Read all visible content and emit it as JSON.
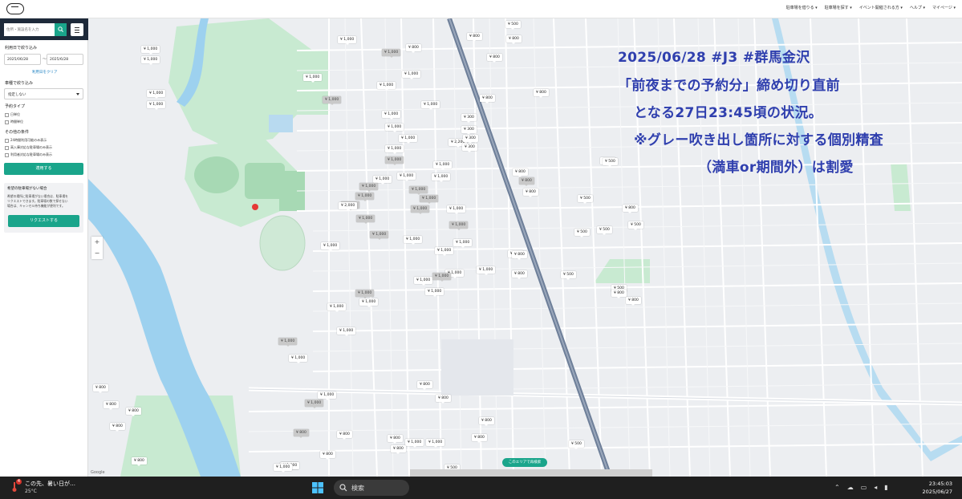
{
  "header": {
    "nav": [
      "駐車場を借りる ▾",
      "駐車場を探す ▾",
      "イベント開催される方 ▾",
      "ヘルプ ▾",
      "マイページ ▾"
    ]
  },
  "sidebar": {
    "search_placeholder": "住所・施設名を入力",
    "period_title": "利用日で絞り込み",
    "date_from": "2025/06/28",
    "date_to": "2025/6/28",
    "date_sep": "〜",
    "clear_link": "利用日をクリア",
    "vehicle_title": "車種で絞り込み",
    "vehicle_value": "指定しない",
    "reserve_title": "予約タイプ",
    "reserve_opts": [
      "日単位",
      "時間単位"
    ],
    "other_title": "その他の条件",
    "other_opts": [
      "24時間利用可能のみ表示",
      "高入庫対応な駐車場のみ表示",
      "利用者対応な駐車場のみ表示"
    ],
    "apply": "適用する",
    "req_title": "希望の駐車場がない場合",
    "req_body": [
      "希望の場所に駐車場がない場合は、駐車場を",
      "リクエストできます。駐車場の数で探せない",
      "場合は、キャンセル待ち機能が便利です。"
    ],
    "req_btn": "リクエストする"
  },
  "map": {
    "annotation": [
      "2025/06/28 #J3 #群馬金沢",
      "「前夜までの予約分」締め切り直前",
      "となる27日23:45頃の状況。",
      "※グレー吹き出し箇所に対する個別精査",
      "（満車or期間外）は割愛"
    ],
    "prices": [
      {
        "label": "¥ 1,000",
        "gray": false
      },
      {
        "label": "¥ 1,000",
        "gray": false
      },
      {
        "label": "¥ 1,000",
        "gray": false
      },
      {
        "label": "¥ 1,000",
        "gray": false
      },
      {
        "label": "¥ 1,000",
        "gray": false
      },
      {
        "label": "¥ 1,000",
        "gray": true
      },
      {
        "label": "¥ 1,000",
        "gray": false
      },
      {
        "label": "¥ 1,000",
        "gray": true
      },
      {
        "label": "¥ 1,000",
        "gray": false
      },
      {
        "label": "¥ 1,000",
        "gray": false
      },
      {
        "label": "¥ 1,000",
        "gray": false
      },
      {
        "label": "¥ 1,000",
        "gray": false
      },
      {
        "label": "¥ 800",
        "gray": false
      },
      {
        "label": "¥ 800",
        "gray": false
      },
      {
        "label": "¥ 500",
        "gray": false
      },
      {
        "label": "¥ 800",
        "gray": false
      },
      {
        "label": "¥ 800",
        "gray": false
      },
      {
        "label": "¥ 800",
        "gray": false
      },
      {
        "label": "¥ 300",
        "gray": false
      },
      {
        "label": "¥ 1,000",
        "gray": false
      },
      {
        "label": "¥ 1,000",
        "gray": false
      },
      {
        "label": "¥ 1,000",
        "gray": false
      },
      {
        "label": "¥ 1,000",
        "gray": true
      },
      {
        "label": "¥ 1,000",
        "gray": false
      },
      {
        "label": "¥ 1,000",
        "gray": false
      },
      {
        "label": "¥ 1,000",
        "gray": true
      },
      {
        "label": "¥ 1,000",
        "gray": true
      },
      {
        "label": "¥ 1,000",
        "gray": false
      },
      {
        "label": "¥ 1,000",
        "gray": true
      },
      {
        "label": "¥ 1,000",
        "gray": true
      },
      {
        "label": "¥ 1,000",
        "gray": false
      },
      {
        "label": "¥ 1,000",
        "gray": true
      },
      {
        "label": "¥ 1,000",
        "gray": true
      },
      {
        "label": "¥ 1,000",
        "gray": true
      },
      {
        "label": "¥ 1,000",
        "gray": true
      },
      {
        "label": "¥ 1,000",
        "gray": false
      },
      {
        "label": "¥ 1,000",
        "gray": true
      },
      {
        "label": "¥ 1,000",
        "gray": false
      },
      {
        "label": "¥ 1,000",
        "gray": false
      },
      {
        "label": "¥ 2,000",
        "gray": false
      },
      {
        "label": "¥ 1,000",
        "gray": false
      },
      {
        "label": "¥ 2,200",
        "gray": false
      },
      {
        "label": "¥ 300",
        "gray": false
      },
      {
        "label": "¥ 300",
        "gray": false
      },
      {
        "label": "¥ 500",
        "gray": false
      },
      {
        "label": "¥ 800",
        "gray": false
      },
      {
        "label": "¥ 800",
        "gray": true
      },
      {
        "label": "¥ 800",
        "gray": false
      },
      {
        "label": "¥ 500",
        "gray": false
      },
      {
        "label": "¥ 500",
        "gray": false
      },
      {
        "label": "¥ 500",
        "gray": false
      },
      {
        "label": "¥ 500",
        "gray": false
      },
      {
        "label": "¥ 800",
        "gray": false
      },
      {
        "label": "¥ 500",
        "gray": false
      },
      {
        "label": "¥ 800",
        "gray": false
      },
      {
        "label": "¥ 500",
        "gray": false
      },
      {
        "label": "¥ 1,000",
        "gray": false
      },
      {
        "label": "¥ 1,000",
        "gray": false
      },
      {
        "label": "¥ 1,000",
        "gray": false
      },
      {
        "label": "¥ 1,000",
        "gray": true
      },
      {
        "label": "¥ 1,000",
        "gray": false
      },
      {
        "label": "¥ 1,000",
        "gray": true
      },
      {
        "label": "¥ 1,000",
        "gray": false
      },
      {
        "label": "¥ 800",
        "gray": false
      },
      {
        "label": "¥ 800",
        "gray": false
      },
      {
        "label": "¥ 800",
        "gray": false
      },
      {
        "label": "¥ 1,000",
        "gray": false
      },
      {
        "label": "¥ 1,000",
        "gray": false
      },
      {
        "label": "¥ 1,000",
        "gray": false
      },
      {
        "label": "¥ 1,000",
        "gray": true
      },
      {
        "label": "¥ 1,000",
        "gray": false
      },
      {
        "label": "¥ 1,000",
        "gray": true
      },
      {
        "label": "¥ 1,000",
        "gray": false
      },
      {
        "label": "¥ 1,000",
        "gray": false
      },
      {
        "label": "¥ 800",
        "gray": false
      },
      {
        "label": "¥ 800",
        "gray": false
      },
      {
        "label": "¥ 800",
        "gray": false
      },
      {
        "label": "¥ 800",
        "gray": false
      },
      {
        "label": "¥ 800",
        "gray": true
      },
      {
        "label": "¥ 800",
        "gray": false
      },
      {
        "label": "¥ 1,000",
        "gray": false
      },
      {
        "label": "¥ 800",
        "gray": false
      },
      {
        "label": "¥ 800",
        "gray": false
      },
      {
        "label": "¥ 800",
        "gray": false
      },
      {
        "label": "¥ 800",
        "gray": false
      },
      {
        "label": "¥ 800",
        "gray": false
      },
      {
        "label": "¥ 800",
        "gray": false
      },
      {
        "label": "¥ 800",
        "gray": false
      },
      {
        "label": "¥ 1,000",
        "gray": false
      },
      {
        "label": "¥ 800",
        "gray": false
      },
      {
        "label": "¥ 500",
        "gray": false
      },
      {
        "label": "¥ 500",
        "gray": false
      },
      {
        "label": "¥ 500",
        "gray": false
      },
      {
        "label": "¥ 300",
        "gray": false
      },
      {
        "label": "¥ 800",
        "gray": false
      },
      {
        "label": "¥ 1,000",
        "gray": false
      },
      {
        "label": "¥ 1,000",
        "gray": false
      },
      {
        "label": "¥ 800",
        "gray": false
      }
    ],
    "area_button": "このエリアで再検索",
    "google": "Google"
  },
  "taskbar": {
    "weather_badge": "4",
    "weather_text": "この先、暑い日が…",
    "temp": "25°C",
    "search": "検索",
    "time": "23:45:03",
    "date": "2025/06/27"
  }
}
